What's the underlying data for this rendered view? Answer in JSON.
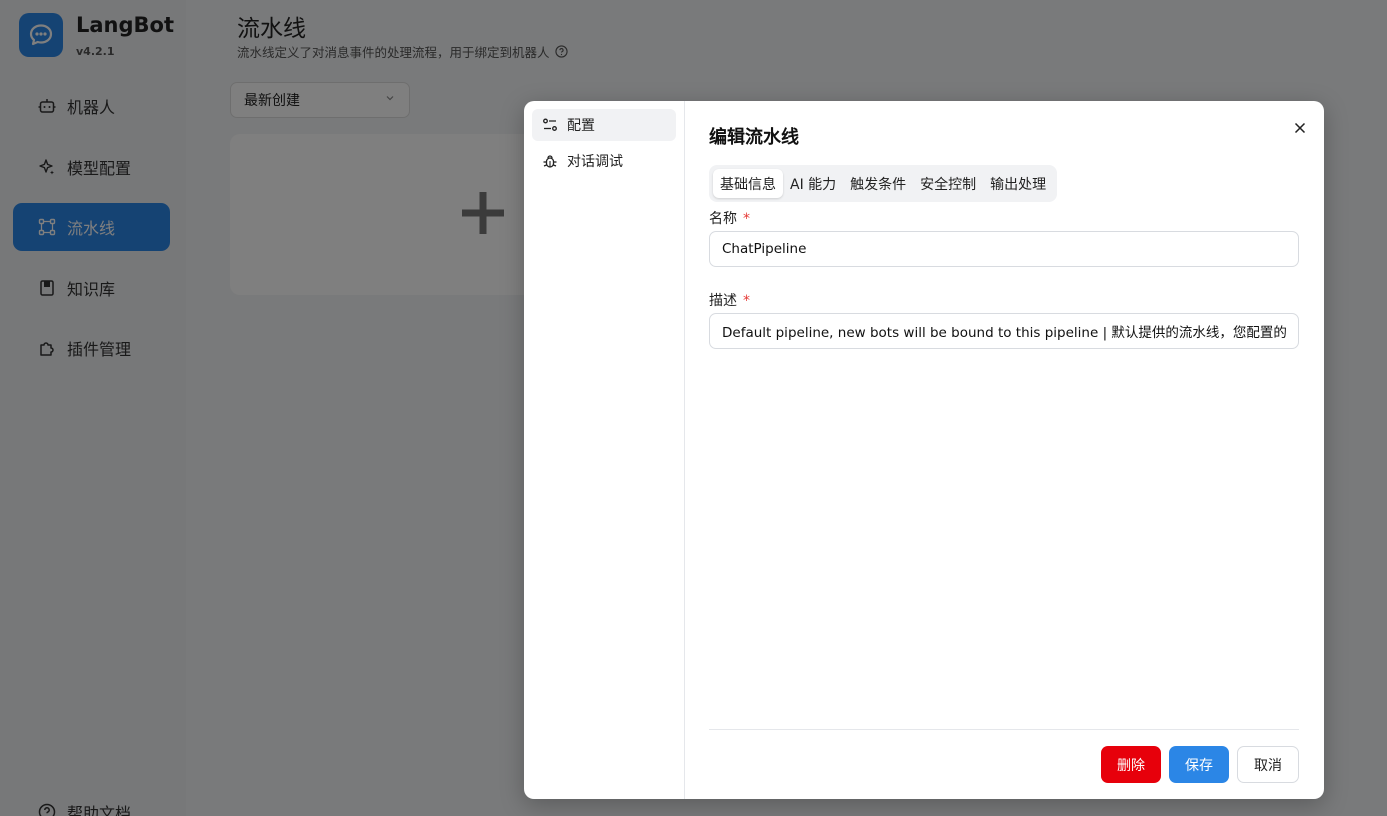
{
  "app": {
    "name": "LangBot",
    "version": "v4.2.1"
  },
  "sidebar": {
    "items": [
      {
        "label": "机器人",
        "icon": "bot-icon"
      },
      {
        "label": "模型配置",
        "icon": "sparkles-icon"
      },
      {
        "label": "流水线",
        "icon": "workflow-icon",
        "active": true
      },
      {
        "label": "知识库",
        "icon": "book-icon"
      },
      {
        "label": "插件管理",
        "icon": "puzzle-icon"
      }
    ],
    "help_label": "帮助文档"
  },
  "page": {
    "title": "流水线",
    "subtitle": "流水线定义了对消息事件的处理流程，用于绑定到机器人",
    "sort_select": {
      "value": "最新创建"
    }
  },
  "dialog": {
    "side_items": [
      {
        "label": "配置",
        "icon": "settings-icon",
        "active": true
      },
      {
        "label": "对话调试",
        "icon": "bug-icon"
      }
    ],
    "title": "编辑流水线",
    "tabs": [
      {
        "label": "基础信息",
        "active": true
      },
      {
        "label": "AI 能力"
      },
      {
        "label": "触发条件"
      },
      {
        "label": "安全控制"
      },
      {
        "label": "输出处理"
      }
    ],
    "fields": {
      "name": {
        "label": "名称",
        "required_mark": "*",
        "value": "ChatPipeline"
      },
      "description": {
        "label": "描述",
        "required_mark": "*",
        "value": "Default pipeline, new bots will be bound to this pipeline | 默认提供的流水线，您配置的机器人"
      }
    },
    "buttons": {
      "delete": "删除",
      "save": "保存",
      "cancel": "取消"
    }
  },
  "colors": {
    "accent": "#2b86e6",
    "danger": "#e7000b",
    "required": "#e53935"
  }
}
